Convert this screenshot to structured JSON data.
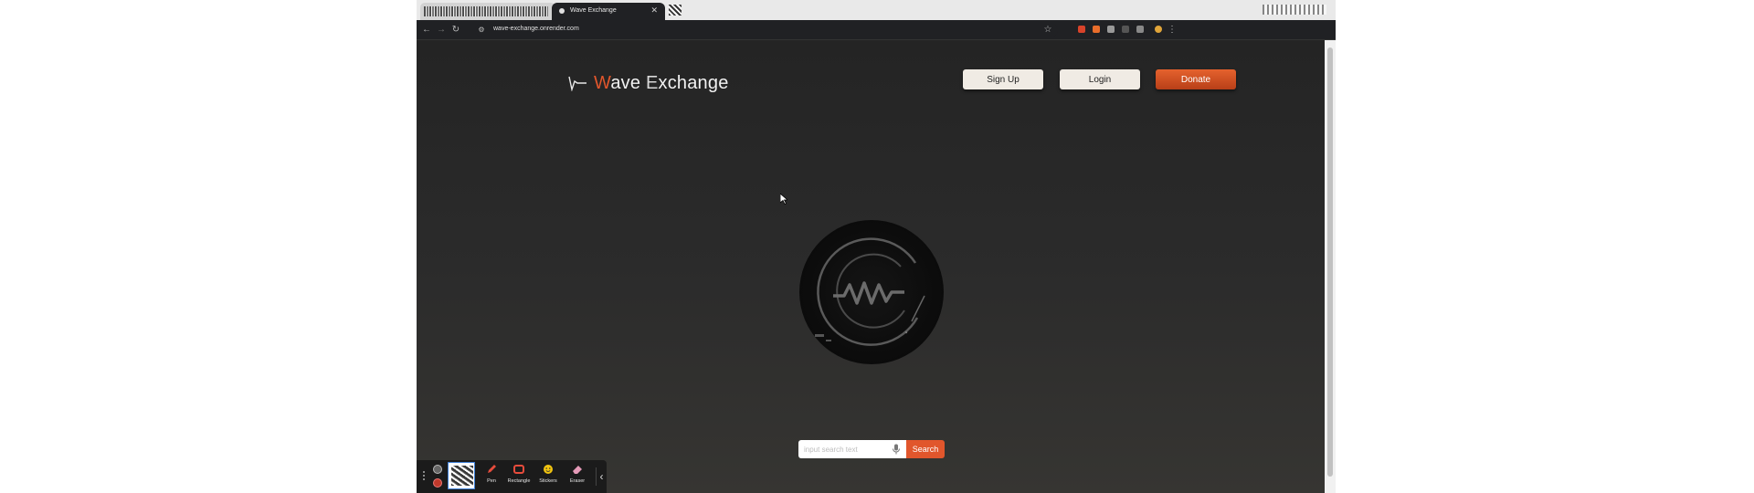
{
  "browser": {
    "active_tab_title": "Wave Exchange",
    "url": "wave-exchange.onrender.com"
  },
  "site": {
    "title_first_letter": "W",
    "title_rest_1": "ave ",
    "title_e": "E",
    "title_rest_2": "xchange",
    "accent_color": "#e1562c"
  },
  "header": {
    "signup_label": "Sign Up",
    "login_label": "Login",
    "donate_label": "Donate"
  },
  "search": {
    "placeholder": "input search text",
    "button_label": "Search"
  },
  "annotation_toolbar": {
    "tools": [
      {
        "label": "Pen",
        "icon": "pen-icon"
      },
      {
        "label": "Rectangle",
        "icon": "rectangle-icon"
      },
      {
        "label": "Stickers",
        "icon": "sticker-icon"
      },
      {
        "label": "Eraser",
        "icon": "eraser-icon"
      }
    ]
  }
}
